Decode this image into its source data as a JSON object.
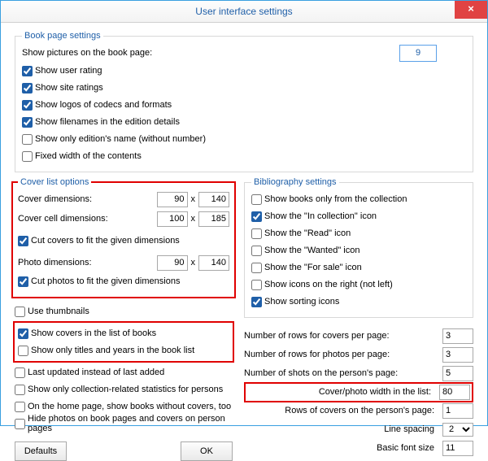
{
  "window": {
    "title": "User interface settings",
    "close": "×"
  },
  "book_page": {
    "legend": "Book page settings",
    "pictures_label": "Show pictures on the book page:",
    "pictures_value": "9",
    "show_user_rating": "Show user rating",
    "show_site_ratings": "Show site ratings",
    "show_logos": "Show logos of codecs and formats",
    "show_filenames": "Show filenames in the edition details",
    "show_only_edition": "Show only edition's name (without number)",
    "fixed_width": "Fixed width of the contents"
  },
  "cover": {
    "legend": "Cover list options",
    "cover_dim_label": "Cover dimensions:",
    "cover_w": "90",
    "cover_h": "140",
    "cell_dim_label": "Cover cell dimensions:",
    "cell_w": "100",
    "cell_h": "185",
    "cut_covers": "Cut covers to fit the given dimensions",
    "photo_dim_label": "Photo dimensions:",
    "photo_w": "90",
    "photo_h": "140",
    "cut_photos": "Cut photos to fit the given dimensions"
  },
  "biblio": {
    "legend": "Bibliography settings",
    "books_only": "Show books only from the collection",
    "in_collection": "Show the \"In collection\" icon",
    "read": "Show the \"Read\" icon",
    "wanted": "Show the \"Wanted\" icon",
    "for_sale": "Show the \"For sale\" icon",
    "icons_right": "Show icons on the right (not left)",
    "sorting": "Show sorting icons"
  },
  "lists": {
    "use_thumbs": "Use thumbnails",
    "show_covers": "Show covers in the list of books",
    "only_titles": "Show only titles and years in the book list",
    "last_updated": "Last updated instead of last added",
    "stats": "Show only collection-related statistics for persons",
    "home_nocover": "On the home page, show books without covers, too",
    "hide_photos": "Hide photos on book pages and covers on person pages"
  },
  "numbers": {
    "covers_rows_l": "Number of rows for covers per page:",
    "covers_rows_v": "3",
    "photos_rows_l": "Number of rows for photos per page:",
    "photos_rows_v": "3",
    "shots_l": "Number of shots on the person's page:",
    "shots_v": "5",
    "width_l": "Cover/photo width in the list:",
    "width_v": "80",
    "person_rows_l": "Rows of covers on the person's page:",
    "person_rows_v": "1",
    "spacing_l": "Line spacing",
    "spacing_v": "2",
    "font_l": "Basic font size",
    "font_v": "11"
  },
  "buttons": {
    "defaults": "Defaults",
    "ok": "OK"
  }
}
